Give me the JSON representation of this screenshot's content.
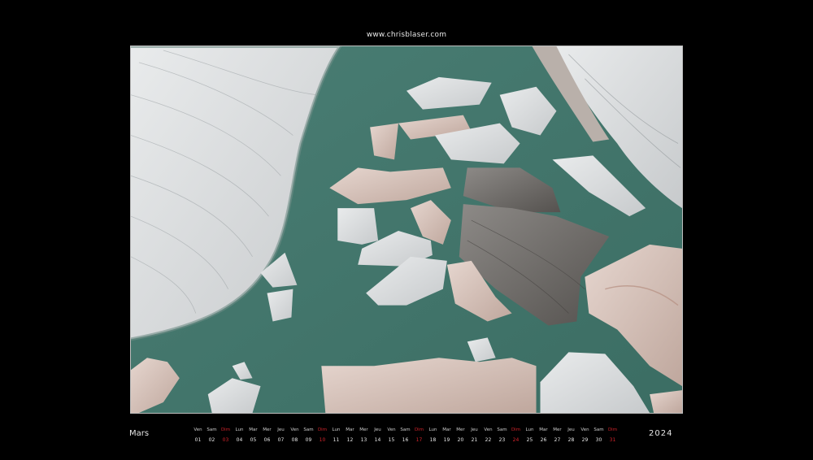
{
  "header": {
    "website": "www.chrisblaser.com"
  },
  "calendar": {
    "month": "Mars",
    "year": "2024",
    "accent_color": "#d4242b",
    "days": [
      {
        "name": "Ven",
        "num": "01"
      },
      {
        "name": "Sam",
        "num": "02"
      },
      {
        "name": "Dim",
        "num": "03",
        "sunday": true
      },
      {
        "name": "Lun",
        "num": "04"
      },
      {
        "name": "Mar",
        "num": "05"
      },
      {
        "name": "Mer",
        "num": "06"
      },
      {
        "name": "Jeu",
        "num": "07"
      },
      {
        "name": "Ven",
        "num": "08"
      },
      {
        "name": "Sam",
        "num": "09"
      },
      {
        "name": "Dim",
        "num": "10",
        "sunday": true
      },
      {
        "name": "Lun",
        "num": "11"
      },
      {
        "name": "Mar",
        "num": "12"
      },
      {
        "name": "Mer",
        "num": "13"
      },
      {
        "name": "Jeu",
        "num": "14"
      },
      {
        "name": "Ven",
        "num": "15"
      },
      {
        "name": "Sam",
        "num": "16"
      },
      {
        "name": "Dim",
        "num": "17",
        "sunday": true
      },
      {
        "name": "Lun",
        "num": "18"
      },
      {
        "name": "Mar",
        "num": "19"
      },
      {
        "name": "Mer",
        "num": "20"
      },
      {
        "name": "Jeu",
        "num": "21"
      },
      {
        "name": "Ven",
        "num": "22"
      },
      {
        "name": "Sam",
        "num": "23"
      },
      {
        "name": "Dim",
        "num": "24",
        "sunday": true
      },
      {
        "name": "Lun",
        "num": "25"
      },
      {
        "name": "Mar",
        "num": "26"
      },
      {
        "name": "Mer",
        "num": "27"
      },
      {
        "name": "Jeu",
        "num": "28"
      },
      {
        "name": "Ven",
        "num": "29"
      },
      {
        "name": "Sam",
        "num": "30"
      },
      {
        "name": "Dim",
        "num": "31",
        "sunday": true
      }
    ]
  }
}
